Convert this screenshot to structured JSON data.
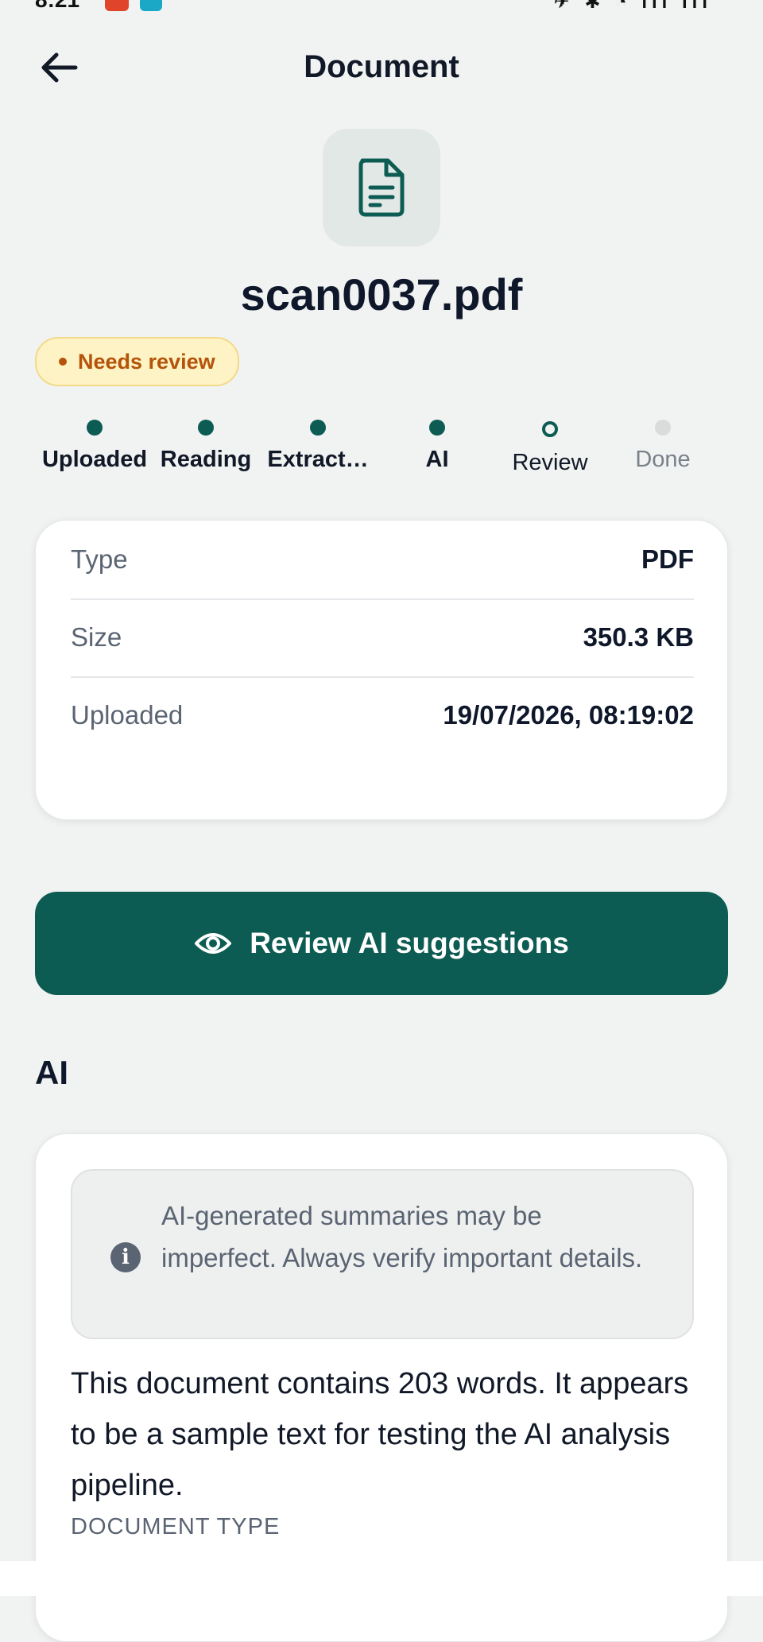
{
  "status_bar": {
    "time": "8:21",
    "icons": "✈ ✱ ◔ ıll ıll"
  },
  "header": {
    "title": "Document"
  },
  "file": {
    "name": "scan0037.pdf",
    "status": "Needs review"
  },
  "steps": [
    {
      "label": "Uploaded",
      "state": "done"
    },
    {
      "label": "Reading",
      "state": "done"
    },
    {
      "label": "Extract…",
      "state": "done"
    },
    {
      "label": "AI",
      "state": "done"
    },
    {
      "label": "Review",
      "state": "current"
    },
    {
      "label": "Done",
      "state": "pending"
    }
  ],
  "details": [
    {
      "label": "Type",
      "value": "PDF"
    },
    {
      "label": "Size",
      "value": "350.3 KB"
    },
    {
      "label": "Uploaded",
      "value": "19/07/2026, 08:19:02"
    }
  ],
  "actions": {
    "review_label": "Review AI suggestions"
  },
  "ai": {
    "heading": "AI",
    "disclaimer": "AI-generated summaries may be imperfect. Always verify important details.",
    "summary": "This document contains 203 words. It appears to be a sample text for testing the AI analysis pipeline.",
    "document_type_label": "DOCUMENT TYPE"
  },
  "colors": {
    "primary": "#0d5c53",
    "badge_bg": "#fdf3c4",
    "badge_text": "#b45309",
    "background": "#f1f3f2"
  },
  "icons": {
    "back": "arrow-left-icon",
    "file": "file-text-icon",
    "review": "eye-icon",
    "info": "info-icon"
  }
}
